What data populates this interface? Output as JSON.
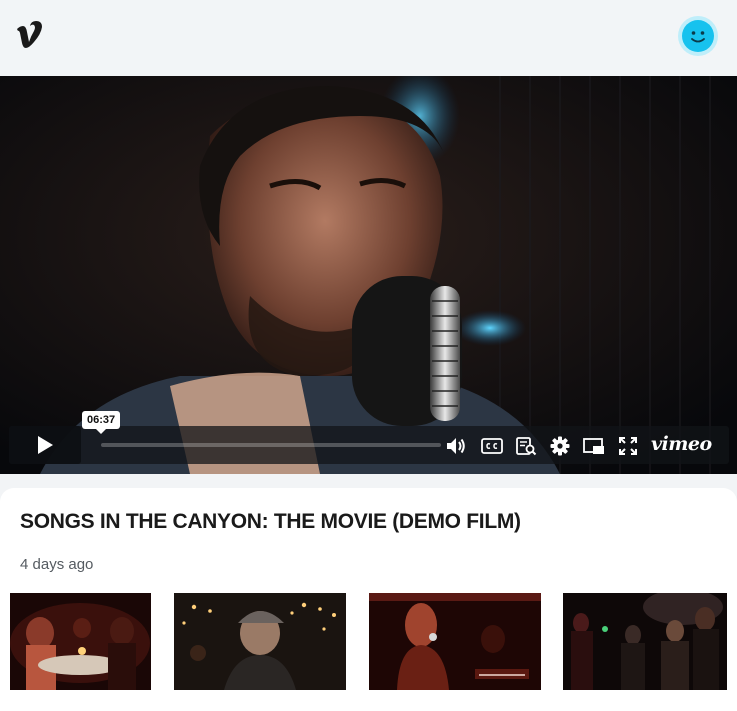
{
  "header": {
    "logo_icon": "vimeo-v-logo",
    "avatar_icon": "smiley-face-avatar",
    "brand_color": "#17c2ee"
  },
  "player": {
    "hover_time": "06:37",
    "progress": 0,
    "brand_wordmark": "vimeo",
    "controls": [
      "play-icon",
      "volume-icon",
      "closed-captions-icon",
      "transcript-icon",
      "settings-icon",
      "picture-in-picture-icon",
      "fullscreen-icon"
    ]
  },
  "video_info": {
    "title": "SONGS IN THE CANYON: THE MOVIE (DEMO FILM)",
    "posted": "4 days ago"
  },
  "related_videos": [
    {
      "scene": "couple-at-candlelit-table"
    },
    {
      "scene": "man-in-cap-night-bokeh"
    },
    {
      "scene": "singer-red-stage-light"
    },
    {
      "scene": "band-performing-dark-stage"
    }
  ]
}
